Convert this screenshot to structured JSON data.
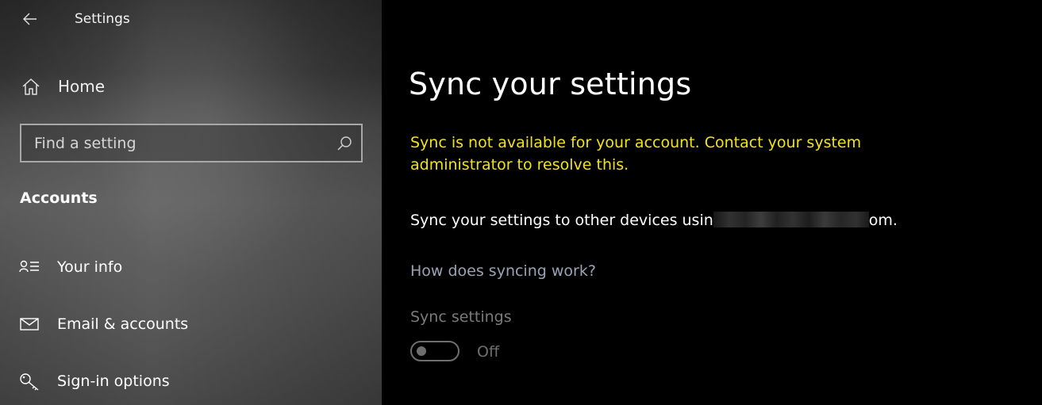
{
  "window": {
    "title": "Settings"
  },
  "sidebar": {
    "back_icon": "back-arrow-icon",
    "home": {
      "label": "Home",
      "icon": "home-icon"
    },
    "search": {
      "placeholder": "Find a setting",
      "icon": "search-icon"
    },
    "section_title": "Accounts",
    "items": [
      {
        "label": "Your info",
        "icon": "person-card-icon"
      },
      {
        "label": "Email & accounts",
        "icon": "mail-icon"
      },
      {
        "label": "Sign-in options",
        "icon": "key-icon"
      }
    ]
  },
  "main": {
    "title": "Sync your settings",
    "warning": "Sync is not available for your account. Contact your system administrator to resolve this.",
    "description_prefix": "Sync your settings to other devices usin",
    "description_suffix": "om.",
    "help_link": "How does syncing work?",
    "sync_settings": {
      "label": "Sync settings",
      "state": "Off",
      "enabled": false
    }
  },
  "colors": {
    "warning": "#f2e21c",
    "link": "#9aa3b5",
    "disabled": "#6e6e6e",
    "background": "#000000"
  }
}
